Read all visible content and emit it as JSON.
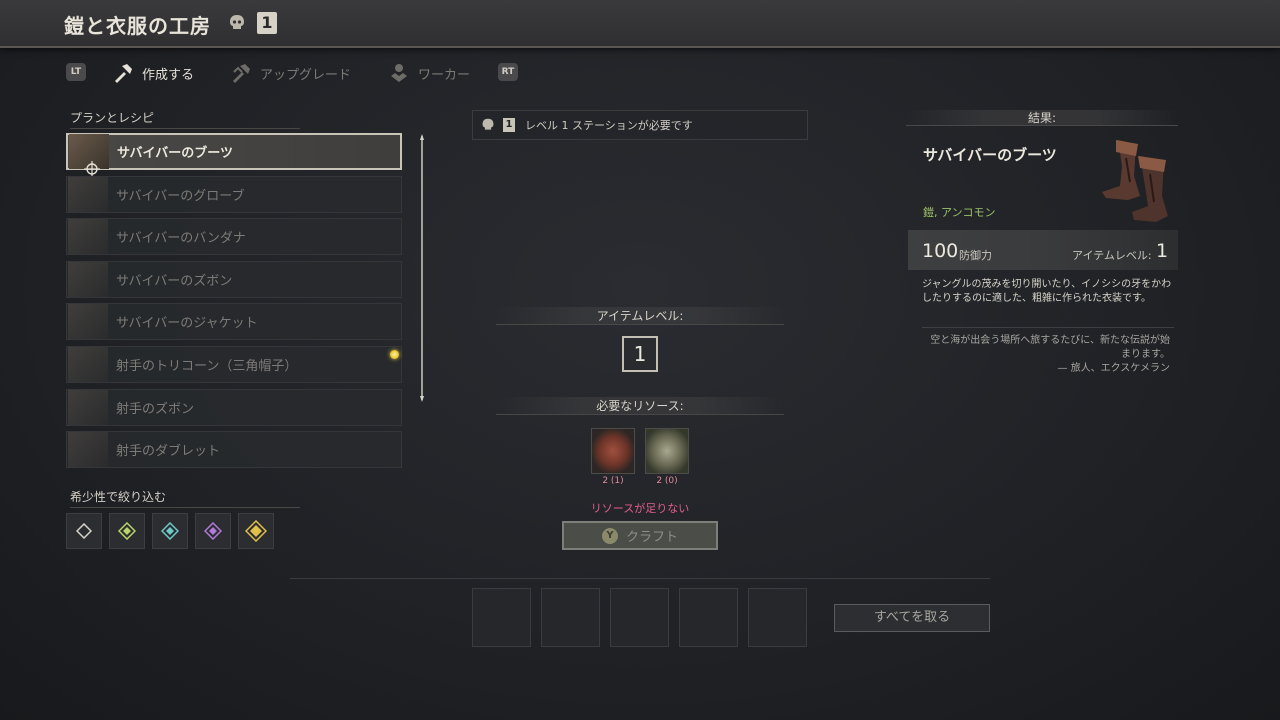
{
  "header": {
    "title": "鎧と衣服の工房",
    "level": "1"
  },
  "tabs": {
    "left_button": "LT",
    "right_button": "RT",
    "items": [
      {
        "label": "作成する",
        "active": true,
        "icon": "hammer-icon"
      },
      {
        "label": "アップグレード",
        "active": false,
        "icon": "upgrade-icon"
      },
      {
        "label": "ワーカー",
        "active": false,
        "icon": "worker-icon"
      }
    ]
  },
  "plans": {
    "heading": "プランとレシピ",
    "items": [
      {
        "label": "サバイバーのブーツ",
        "selected": true
      },
      {
        "label": "サバイバーのグローブ"
      },
      {
        "label": "サバイバーのバンダナ"
      },
      {
        "label": "サバイバーのズボン"
      },
      {
        "label": "サバイバーのジャケット"
      },
      {
        "label": "射手のトリコーン（三角帽子）",
        "new": true
      },
      {
        "label": "射手のズボン"
      },
      {
        "label": "射手のダブレット"
      }
    ]
  },
  "filter": {
    "heading": "希少性で絞り込む",
    "rarities": [
      {
        "name": "common",
        "color": "#d8d4ca"
      },
      {
        "name": "uncommon",
        "color": "#b9d46a"
      },
      {
        "name": "rare",
        "color": "#6ec9c9"
      },
      {
        "name": "epic",
        "color": "#b27ad9"
      },
      {
        "name": "legendary",
        "color": "#e0c04a"
      }
    ]
  },
  "requirement": {
    "level": "1",
    "text": "レベル 1 ステーションが必要です"
  },
  "item_level": {
    "heading": "アイテムレベル:",
    "value": "1"
  },
  "resources": {
    "heading": "必要なリソース:",
    "items": [
      {
        "count": "2 (1)"
      },
      {
        "count": "2 (0)"
      }
    ],
    "warning": "リソースが足りない"
  },
  "craft": {
    "key": "Y",
    "label": "クラフト"
  },
  "take_all": "すべてを取る",
  "result": {
    "heading": "結果:",
    "name": "サバイバーのブーツ",
    "type": "鎧, アンコモン",
    "defense_value": "100",
    "defense_label": "防御力",
    "item_level_label": "アイテムレベル:",
    "item_level_value": "1",
    "description": "ジャングルの茂みを切り開いたり、イノシシの牙をかわしたりするのに適した、粗雑に作られた衣装です。",
    "quote_line1": "空と海が出会う場所へ旅するたびに、新たな伝説が始まります。",
    "quote_author": "— 旅人、エクスケメラン"
  },
  "colors": {
    "accent_green": "#9bc46a",
    "warning_pink": "#e45d8a",
    "text_light": "#ece8de"
  }
}
